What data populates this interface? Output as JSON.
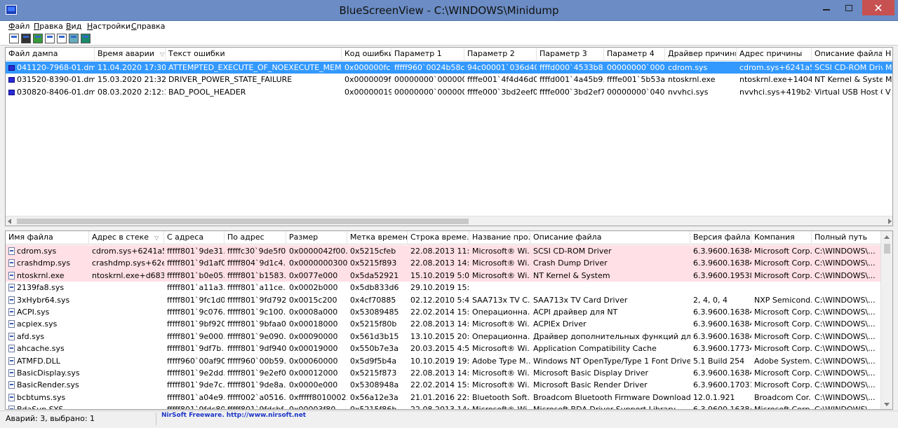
{
  "window": {
    "title": "BlueScreenView  -  C:\\WINDOWS\\Minidump",
    "min_label": "",
    "close_label": "✕"
  },
  "menu": [
    "Файл",
    "Правка",
    "Вид",
    "Настройки",
    "Справка"
  ],
  "toolbar": [
    "properties-icon",
    "save-icon",
    "refresh-icon",
    "copy-icon",
    "options-icon",
    "find-icon",
    "exit-icon"
  ],
  "dumps": {
    "columns": [
      "Файл дампа",
      "Время аварии",
      "Текст ошибки",
      "Код ошибки",
      "Параметр 1",
      "Параметр 2",
      "Параметр 3",
      "Параметр 4",
      "Драйвер причины",
      "Адрес причины",
      "Описание файла",
      "Н"
    ],
    "sort_column": 1,
    "rows": [
      {
        "selected": true,
        "cells": [
          "041120-7968-01.dmp",
          "11.04.2020 17:30:39",
          "ATTEMPTED_EXECUTE_OF_NOEXECUTE_MEMORY",
          "0x000000fc",
          "fffff960`0024b58c",
          "94c00001`036d40...",
          "ffffd000`4533b8...",
          "00000000`000...",
          "cdrom.sys",
          "cdrom.sys+6241a5...",
          "SCSI CD-ROM Driv...",
          "M"
        ]
      },
      {
        "selected": false,
        "cells": [
          "031520-8390-01.dmp",
          "15.03.2020 21:32:32",
          "DRIVER_POWER_STATE_FAILURE",
          "0x0000009f",
          "00000000`00000003",
          "ffffe001`4f4d46d0",
          "ffffd001`4a45b9...",
          "ffffe001`5b53a...",
          "ntoskrnl.exe",
          "ntoskrnl.exe+1404a0",
          "NT Kernel & System",
          "M"
        ]
      },
      {
        "selected": false,
        "cells": [
          "030820-8406-01.dmp",
          "08.03.2020 2:12:14",
          "BAD_POOL_HEADER",
          "0x00000019",
          "00000000`00000020",
          "ffffe000`3bd2eef0",
          "ffffe000`3bd2ef70",
          "00000000`040...",
          "nvvhci.sys",
          "nvvhci.sys+419b26...",
          "Virtual USB Host C...",
          "V"
        ]
      }
    ]
  },
  "drivers": {
    "columns": [
      "Имя файла",
      "Адрес в стеке",
      "С адреса",
      "По адрес",
      "Размер",
      "Метка времени",
      "Строка време...",
      "Название про...",
      "Описание файла",
      "Версия файла",
      "Компания",
      "Полный путь"
    ],
    "sort_column": 1,
    "rows": [
      {
        "highlight": true,
        "cells": [
          "cdrom.sys",
          "cdrom.sys+6241a5...",
          "fffff801`9de31...",
          "fffffc30`9de5f0...",
          "0x0000042f00...",
          "0x5215cfeb",
          "22.08.2013 11:...",
          "Microsoft® Wi...",
          "SCSI CD-ROM Driver",
          "6.3.9600.16384...",
          "Microsoft Corp...",
          "C:\\WINDOWS\\..."
        ]
      },
      {
        "highlight": true,
        "cells": [
          "crashdmp.sys",
          "crashdmp.sys+62e...",
          "fffff801`9d1af0...",
          "fffff804`9d1c4...",
          "0x0000000300...",
          "0x5215f893",
          "22.08.2013 14:...",
          "Microsoft® Wi...",
          "Crash Dump Driver",
          "6.3.9600.16384...",
          "Microsoft Corp...",
          "C:\\WINDOWS\\..."
        ]
      },
      {
        "highlight": true,
        "cells": [
          "ntoskrnl.exe",
          "ntoskrnl.exe+d683c",
          "fffff801`b0e05...",
          "fffff801`b1583...",
          "0x0077e000",
          "0x5da52921",
          "15.10.2019 5:0...",
          "Microsoft® Wi...",
          "NT Kernel & System",
          "6.3.9600.19538...",
          "Microsoft Corp...",
          "C:\\WINDOWS\\..."
        ]
      },
      {
        "highlight": false,
        "cells": [
          "2139fa8.sys",
          "",
          "fffff801`a11a3...",
          "fffff801`a11ce...",
          "0x0002b000",
          "0x5db833d6",
          "29.10.2019 15:...",
          "",
          "",
          "",
          "",
          ""
        ]
      },
      {
        "highlight": false,
        "cells": [
          "3xHybr64.sys",
          "",
          "fffff801`9fc1d0...",
          "fffff801`9fd792...",
          "0x0015c200",
          "0x4cf70885",
          "02.12.2010 5:4...",
          "SAA713x TV C...",
          "SAA713x TV Card Driver",
          "2, 4, 0, 4",
          "NXP Semicond...",
          "C:\\WINDOWS\\..."
        ]
      },
      {
        "highlight": false,
        "cells": [
          "ACPI.sys",
          "",
          "fffff801`9c076...",
          "fffff801`9c100...",
          "0x0008a000",
          "0x53089485",
          "22.02.2014 15:...",
          "Операционна...",
          "ACPI драйвер для NT",
          "6.3.9600.16384...",
          "Microsoft Corp...",
          "C:\\WINDOWS\\..."
        ]
      },
      {
        "highlight": false,
        "cells": [
          "acpiex.sys",
          "",
          "fffff801`9bf920...",
          "fffff801`9bfaa0...",
          "0x00018000",
          "0x5215f80b",
          "22.08.2013 14:...",
          "Microsoft® Wi...",
          "ACPIEx Driver",
          "6.3.9600.16384...",
          "Microsoft Corp...",
          "C:\\WINDOWS\\..."
        ]
      },
      {
        "highlight": false,
        "cells": [
          "afd.sys",
          "",
          "fffff801`9e000...",
          "fffff801`9e090...",
          "0x00090000",
          "0x561d3b15",
          "13.10.2015 20:...",
          "Операционна...",
          "Драйвер дополнительных функций для W...",
          "6.3.9600.16384...",
          "Microsoft Corp...",
          "C:\\WINDOWS\\..."
        ]
      },
      {
        "highlight": false,
        "cells": [
          "ahcache.sys",
          "",
          "fffff801`9df7b...",
          "fffff801`9df940...",
          "0x00019000",
          "0x550b7e3a",
          "20.03.2015 4:5...",
          "Microsoft® Wi...",
          "Application Compatibility Cache",
          "6.3.9600.17734...",
          "Microsoft Corp...",
          "C:\\WINDOWS\\..."
        ]
      },
      {
        "highlight": false,
        "cells": [
          "ATMFD.DLL",
          "",
          "fffff960`00af90...",
          "fffff960`00b59...",
          "0x00060000",
          "0x5d9f5b4a",
          "10.10.2019 19:...",
          "Adobe Type M...",
          "Windows NT OpenType/Type 1 Font Driver",
          "5.1 Build 254",
          "Adobe System...",
          "C:\\WINDOWS\\..."
        ]
      },
      {
        "highlight": false,
        "cells": [
          "BasicDisplay.sys",
          "",
          "fffff801`9e2dd...",
          "fffff801`9e2ef0...",
          "0x00012000",
          "0x5215f873",
          "22.08.2013 14:...",
          "Microsoft® Wi...",
          "Microsoft Basic Display Driver",
          "6.3.9600.16384...",
          "Microsoft Corp...",
          "C:\\WINDOWS\\..."
        ]
      },
      {
        "highlight": false,
        "cells": [
          "BasicRender.sys",
          "",
          "fffff801`9de7c...",
          "fffff801`9de8a...",
          "0x0000e000",
          "0x5308948a",
          "22.02.2014 15:...",
          "Microsoft® Wi...",
          "Microsoft Basic Render Driver",
          "6.3.9600.17031...",
          "Microsoft Corp...",
          "C:\\WINDOWS\\..."
        ]
      },
      {
        "highlight": false,
        "cells": [
          "bcbtums.sys",
          "",
          "fffff801`a04e9...",
          "fffff002`a0516...",
          "0xfffff8010002...",
          "0x56a12e3a",
          "21.01.2016 22:...",
          "Bluetooth Soft...",
          "Broadcom Bluetooth Firmware Download Fi...",
          "12.0.1.921",
          "Broadcom Cor...",
          "C:\\WINDOWS\\..."
        ]
      },
      {
        "highlight": false,
        "cells": [
          "BdaSup.SYS",
          "",
          "fffff801`9fdc80...",
          "fffff801`9fdcbf...",
          "0x00003f80",
          "0x5215f86b",
          "22.08.2013 14:...",
          "Microsoft® Wi...",
          "Microsoft BDA Driver Support Library",
          "6.3.9600.16384...",
          "Microsoft Corp...",
          "C:\\WINDOWS\\..."
        ]
      }
    ]
  },
  "status": {
    "counts": "Аварий: 3, выбрано: 1",
    "credit": "NirSoft Freeware.  http://www.nirsoft.net"
  }
}
